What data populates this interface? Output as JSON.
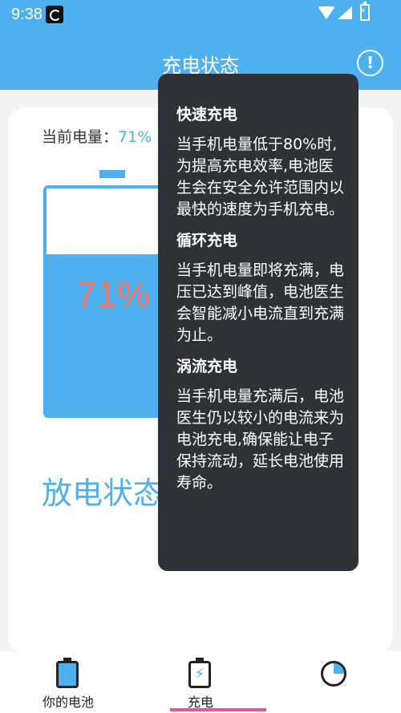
{
  "status_bar": {
    "time": "9:38"
  },
  "header": {
    "title": "充电状态",
    "info_label": "!"
  },
  "main": {
    "level_label": "当前电量：",
    "level_value": "71%",
    "battery_percent": "71%",
    "battery_level": 0.71,
    "discharge_title": "放电状态"
  },
  "tooltip": {
    "sections": [
      {
        "title": "快速充电",
        "body": "当手机电量低于80%时,为提高充电效率,电池医生会在安全允许范围内以最快的速度为手机充电。"
      },
      {
        "title": "循环充电",
        "body": "当手机电量即将充满，电压已达到峰值，电池医生会智能减小电流直到充满为止。"
      },
      {
        "title": "涡流充电",
        "body": "当手机电量充满后，电池医生仍以较小的电流来为电池充电,确保能让电子保持流动，延长电池使用寿命。"
      }
    ]
  },
  "bottom_nav": {
    "items": [
      {
        "label": "你的电池",
        "icon": "battery-icon"
      },
      {
        "label": "充电",
        "icon": "charging-icon"
      },
      {
        "label": "",
        "icon": "pie-chart-icon"
      }
    ],
    "active_index": 1
  },
  "colors": {
    "accent": "#4fb0f0",
    "percent_text": "#f07668",
    "tooltip_bg": "#2e3236",
    "active_underline": "#e9559b"
  }
}
